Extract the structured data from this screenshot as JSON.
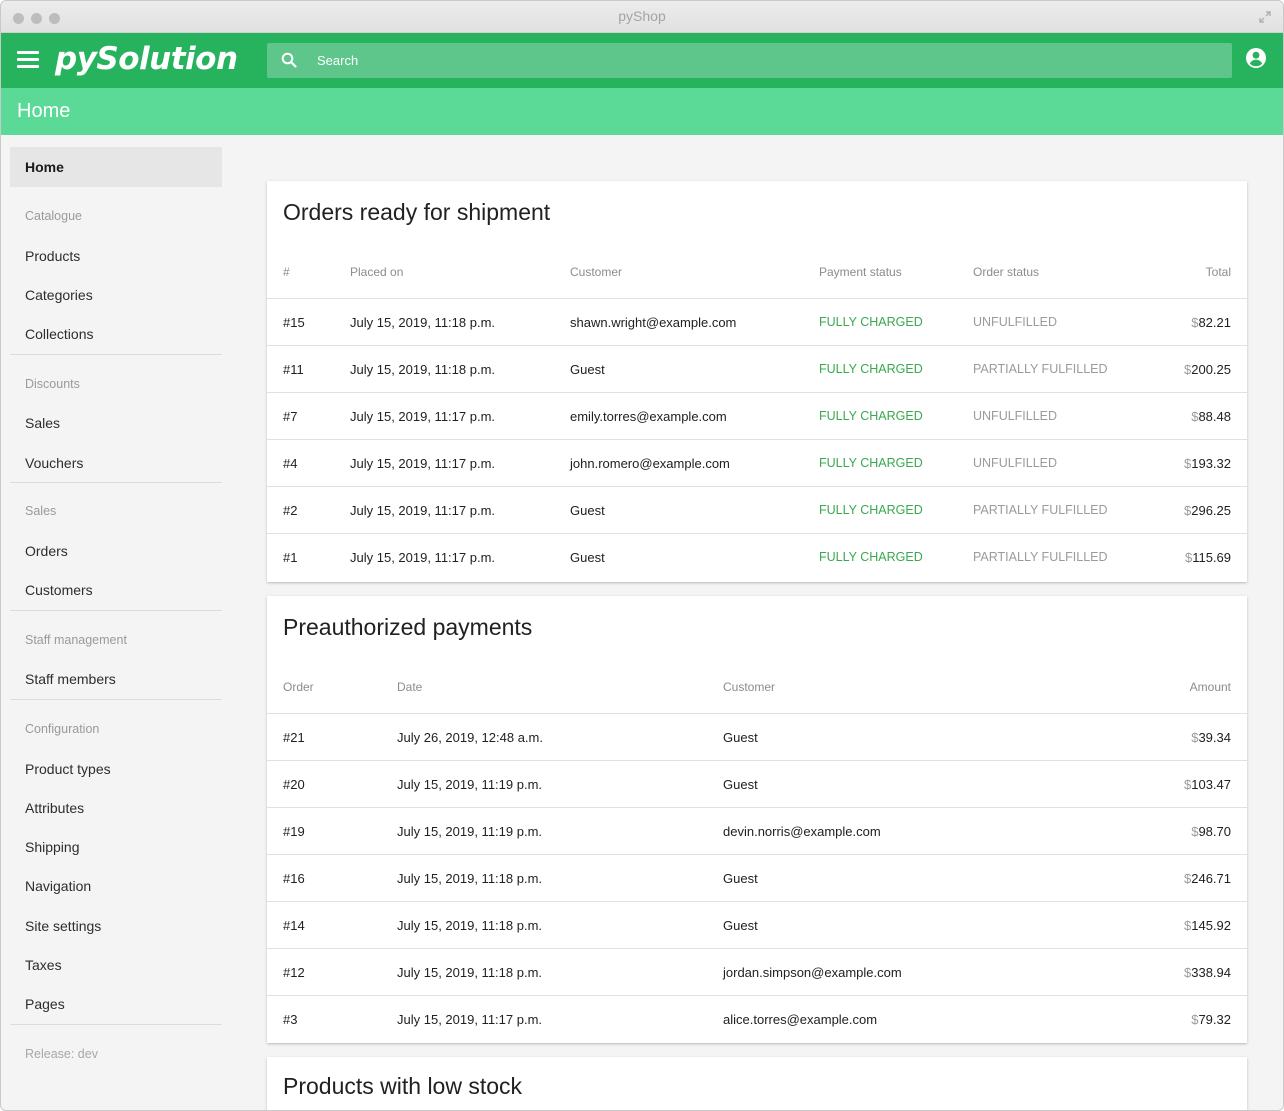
{
  "window": {
    "title": "pyShop"
  },
  "appbar": {
    "logo": "pySolution",
    "search_placeholder": "Search",
    "accent": "#27b35e"
  },
  "header": {
    "title": "Home"
  },
  "sidebar": {
    "home": "Home",
    "catalogue": {
      "label": "Catalogue",
      "items": [
        "Products",
        "Categories",
        "Collections"
      ]
    },
    "discounts": {
      "label": "Discounts",
      "items": [
        "Sales",
        "Vouchers"
      ]
    },
    "sales": {
      "label": "Sales",
      "items": [
        "Orders",
        "Customers"
      ]
    },
    "staff": {
      "label": "Staff management",
      "items": [
        "Staff members"
      ]
    },
    "configuration": {
      "label": "Configuration",
      "items": [
        "Product types",
        "Attributes",
        "Shipping",
        "Navigation",
        "Site settings",
        "Taxes",
        "Pages"
      ]
    },
    "release": "Release: dev"
  },
  "shipment": {
    "title": "Orders ready for shipment",
    "columns": [
      "#",
      "Placed on",
      "Customer",
      "Payment status",
      "Order status",
      "Total"
    ],
    "rows": [
      {
        "id": "#15",
        "date": "July 15, 2019, 11:18 p.m.",
        "customer": "shawn.wright@example.com",
        "payment": "FULLY CHARGED",
        "status": "UNFULFILLED",
        "cur": "$",
        "total": "82.21"
      },
      {
        "id": "#11",
        "date": "July 15, 2019, 11:18 p.m.",
        "customer": "Guest",
        "payment": "FULLY CHARGED",
        "status": "PARTIALLY FULFILLED",
        "cur": "$",
        "total": "200.25"
      },
      {
        "id": "#7",
        "date": "July 15, 2019, 11:17 p.m.",
        "customer": "emily.torres@example.com",
        "payment": "FULLY CHARGED",
        "status": "UNFULFILLED",
        "cur": "$",
        "total": "88.48"
      },
      {
        "id": "#4",
        "date": "July 15, 2019, 11:17 p.m.",
        "customer": "john.romero@example.com",
        "payment": "FULLY CHARGED",
        "status": "UNFULFILLED",
        "cur": "$",
        "total": "193.32"
      },
      {
        "id": "#2",
        "date": "July 15, 2019, 11:17 p.m.",
        "customer": "Guest",
        "payment": "FULLY CHARGED",
        "status": "PARTIALLY FULFILLED",
        "cur": "$",
        "total": "296.25"
      },
      {
        "id": "#1",
        "date": "July 15, 2019, 11:17 p.m.",
        "customer": "Guest",
        "payment": "FULLY CHARGED",
        "status": "PARTIALLY FULFILLED",
        "cur": "$",
        "total": "115.69"
      }
    ]
  },
  "preauth": {
    "title": "Preauthorized payments",
    "columns": [
      "Order",
      "Date",
      "Customer",
      "Amount"
    ],
    "rows": [
      {
        "id": "#21",
        "date": "July 26, 2019, 12:48 a.m.",
        "customer": "Guest",
        "cur": "$",
        "amount": "39.34"
      },
      {
        "id": "#20",
        "date": "July 15, 2019, 11:19 p.m.",
        "customer": "Guest",
        "cur": "$",
        "amount": "103.47"
      },
      {
        "id": "#19",
        "date": "July 15, 2019, 11:19 p.m.",
        "customer": "devin.norris@example.com",
        "cur": "$",
        "amount": "98.70"
      },
      {
        "id": "#16",
        "date": "July 15, 2019, 11:18 p.m.",
        "customer": "Guest",
        "cur": "$",
        "amount": "246.71"
      },
      {
        "id": "#14",
        "date": "July 15, 2019, 11:18 p.m.",
        "customer": "Guest",
        "cur": "$",
        "amount": "145.92"
      },
      {
        "id": "#12",
        "date": "July 15, 2019, 11:18 p.m.",
        "customer": "jordan.simpson@example.com",
        "cur": "$",
        "amount": "338.94"
      },
      {
        "id": "#3",
        "date": "July 15, 2019, 11:17 p.m.",
        "customer": "alice.torres@example.com",
        "cur": "$",
        "amount": "79.32"
      }
    ]
  },
  "lowstock": {
    "title": "Products with low stock"
  }
}
